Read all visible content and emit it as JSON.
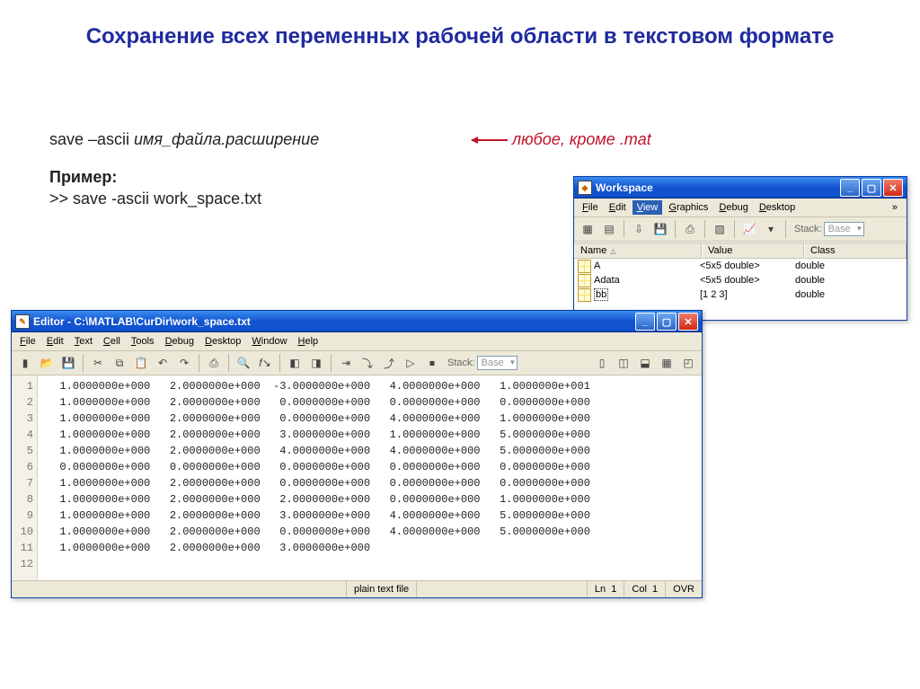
{
  "title": "Сохранение всех переменных рабочей области в текстовом формате",
  "command_syntax": {
    "pre": "save –ascii ",
    "ital": "имя_файла.расширение"
  },
  "example": {
    "label": "Пример:",
    "code": ">> save -ascii work_space.txt"
  },
  "annotation": "любое, кроме .mat",
  "workspace": {
    "title": "Workspace",
    "menu": [
      "File",
      "Edit",
      "View",
      "Graphics",
      "Debug",
      "Desktop"
    ],
    "menu_selected_index": 2,
    "toolbar_stack_label": "Stack:",
    "toolbar_stack_value": "Base",
    "columns": [
      "Name",
      "Value",
      "Class"
    ],
    "rows": [
      {
        "name": "A",
        "value": "<5x5 double>",
        "class": "double"
      },
      {
        "name": "Adata",
        "value": "<5x5 double>",
        "class": "double"
      },
      {
        "name": "bb",
        "value": "[1 2 3]",
        "class": "double",
        "selected": true
      }
    ]
  },
  "editor": {
    "title": "Editor - C:\\MATLAB\\CurDir\\work_space.txt",
    "menu": [
      "File",
      "Edit",
      "Text",
      "Cell",
      "Tools",
      "Debug",
      "Desktop",
      "Window",
      "Help"
    ],
    "toolbar_stack_label": "Stack:",
    "toolbar_stack_value": "Base",
    "lines": [
      "  1.0000000e+000   2.0000000e+000  -3.0000000e+000   4.0000000e+000   1.0000000e+001",
      "  1.0000000e+000   2.0000000e+000   0.0000000e+000   0.0000000e+000   0.0000000e+000",
      "  1.0000000e+000   2.0000000e+000   0.0000000e+000   4.0000000e+000   1.0000000e+000",
      "  1.0000000e+000   2.0000000e+000   3.0000000e+000   1.0000000e+000   5.0000000e+000",
      "  1.0000000e+000   2.0000000e+000   4.0000000e+000   4.0000000e+000   5.0000000e+000",
      "  0.0000000e+000   0.0000000e+000   0.0000000e+000   0.0000000e+000   0.0000000e+000",
      "  1.0000000e+000   2.0000000e+000   0.0000000e+000   0.0000000e+000   0.0000000e+000",
      "  1.0000000e+000   2.0000000e+000   2.0000000e+000   0.0000000e+000   1.0000000e+000",
      "  1.0000000e+000   2.0000000e+000   3.0000000e+000   4.0000000e+000   5.0000000e+000",
      "  1.0000000e+000   2.0000000e+000   0.0000000e+000   4.0000000e+000   5.0000000e+000",
      "  1.0000000e+000   2.0000000e+000   3.0000000e+000",
      ""
    ],
    "status": {
      "type": "plain text file",
      "ln_label": "Ln",
      "ln": "1",
      "col_label": "Col",
      "col": "1",
      "ovr": "OVR"
    }
  }
}
